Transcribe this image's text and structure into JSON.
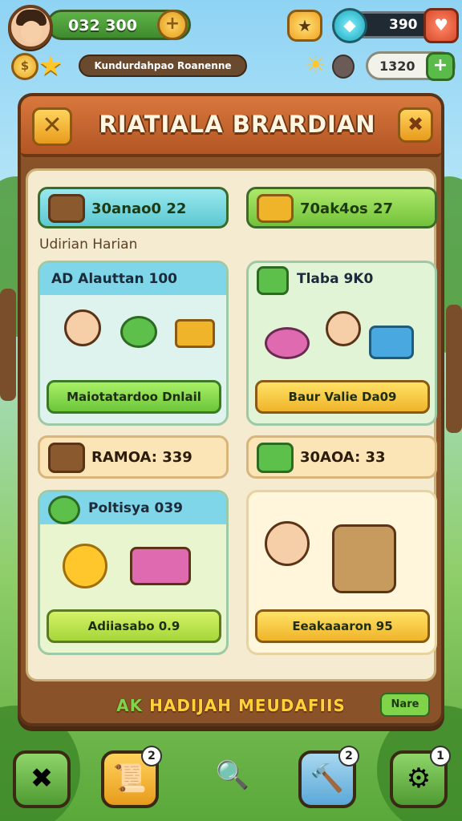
{
  "topbar": {
    "coins": "032 300",
    "gems": "390",
    "avatar": "avatar",
    "add_coins_icon": "plus-icon",
    "gem_chest_icon": "treasure-icon",
    "diamond_icon": "diamond-icon",
    "heart_icon": "heart-icon"
  },
  "row2": {
    "player_name": "Kundurdahpao Roanenne",
    "energy": "1320",
    "energy_add": "+"
  },
  "panel": {
    "title": "RIATIALA BRARDIAN",
    "close": "✖",
    "top_buttons": [
      {
        "label": "30anao0 22",
        "color": "#7ed7e0"
      },
      {
        "label": "70ak4os 27",
        "color": "#8ed84a"
      }
    ],
    "section_label": "Udirian Harian",
    "cards": [
      {
        "title": "AD  Alauttan 100",
        "button": "Maiotatardoo Dnlail",
        "head_color": "#7fd6e8",
        "button_color": "#8ee04e"
      },
      {
        "title": "Tlaba 9K0",
        "button": "Baur Valie Da09",
        "head_color": "#c8f0a8",
        "button_color": "#ffd23c"
      },
      {
        "title": "Poltisya 039",
        "button": "Adiiasabo 0.9",
        "head_color": "#7fd6e8",
        "button_color": "#b6e64a"
      },
      {
        "title": "",
        "button": "Eeakaaaron 95",
        "head_color": "#fff2cf",
        "button_color": "#ffd23c"
      }
    ],
    "wide_rows": [
      {
        "label": "RAMOA: 339"
      },
      {
        "label": "30AOA: 33"
      }
    ],
    "footer_prefix": "AK",
    "footer_text": "HADIJAH MEUDAFIIS",
    "more_button": "Nare"
  },
  "nav": {
    "items": [
      {
        "icon": "close-icon",
        "glyph": "✖",
        "badge": ""
      },
      {
        "icon": "scroll-icon",
        "glyph": "📜",
        "badge": "2"
      },
      {
        "icon": "magnifier-icon",
        "glyph": "🔍",
        "badge": ""
      },
      {
        "icon": "hammer-icon",
        "glyph": "🔨",
        "badge": "2"
      },
      {
        "icon": "settings-icon",
        "glyph": "⚙",
        "badge": "1"
      }
    ]
  }
}
